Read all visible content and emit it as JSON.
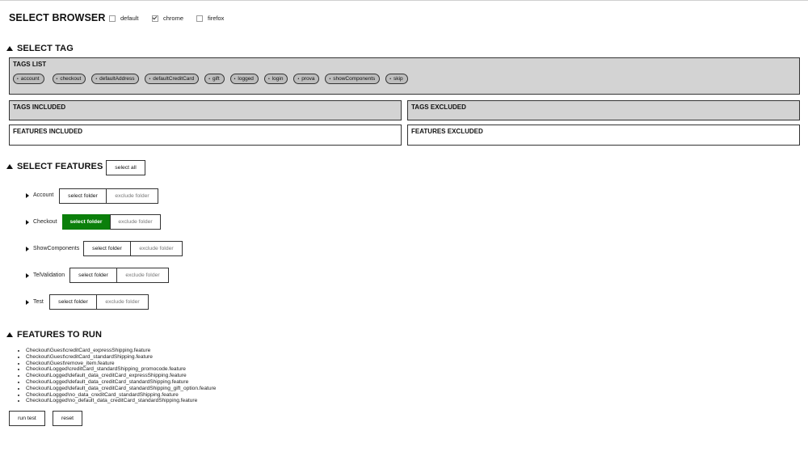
{
  "browser": {
    "title": "SELECT BROWSER",
    "options": [
      {
        "label": "default",
        "checked": false
      },
      {
        "label": "chrome",
        "checked": true
      },
      {
        "label": "firefox",
        "checked": false
      }
    ]
  },
  "tags_section": {
    "title": "SELECT TAG",
    "tags_list_title": "TAGS LIST",
    "tags": [
      "account",
      "checkout",
      "defaultAddress",
      "defaultCreditCard",
      "gift",
      "logged",
      "login",
      "prova",
      "showComponents",
      "skip"
    ],
    "tag_bullet": "•",
    "tags_included_title": "TAGS INCLUDED",
    "tags_excluded_title": "TAGS EXCLUDED",
    "features_included_title": "FEATURES INCLUDED",
    "features_excluded_title": "FEATURES EXCLUDED"
  },
  "features_section": {
    "title": "SELECT FEATURES",
    "select_all_label": "select all",
    "select_folder_label": "select folder",
    "exclude_folder_label": "exclude folder",
    "folders": [
      {
        "name": "Account",
        "selected": false
      },
      {
        "name": "Checkout",
        "selected": true
      },
      {
        "name": "ShowComponents",
        "selected": false
      },
      {
        "name": "TelValidation",
        "selected": false
      },
      {
        "name": "Test",
        "selected": false
      }
    ]
  },
  "run_section": {
    "title": "FEATURES TO RUN",
    "features": [
      "Checkout\\Guest\\creditCard_expressShipping.feature",
      "Checkout\\Guest\\creditCard_standardShipping.feature",
      "Checkout\\Guest\\remove_item.feature",
      "Checkout\\Logged\\creditCard_standardShipping_promocode.feature",
      "Checkout\\Logged\\default_data_creditCard_expressShipping.feature",
      "Checkout\\Logged\\default_data_creditCard_standardShipping.feature",
      "Checkout\\Logged\\default_data_creditCard_standardShipping_gift_option.feature",
      "Checkout\\Logged\\no_data_creditCard_standardShipping.feature",
      "Checkout\\Logged\\no_default_data_creditCard_standardShipping.feature"
    ],
    "run_test_label": "run test",
    "reset_label": "reset"
  },
  "colors": {
    "accent_green": "#0b7f0b",
    "panel_gray": "#d3d3d3"
  }
}
